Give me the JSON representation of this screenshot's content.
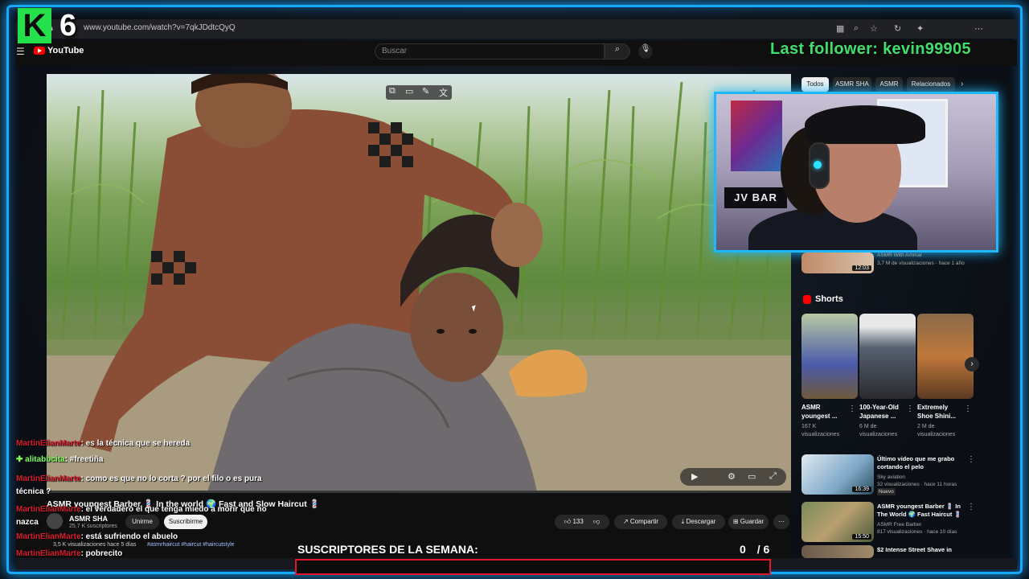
{
  "overlay": {
    "logo_letter": "K",
    "logo_number": "6",
    "last_follower": "Last follower: kevin99905",
    "sub_goal_label": "SUSCRIPTORES DE LA SEMANA:",
    "sub_goal_current": "0",
    "sub_goal_target": "/ 6",
    "sub_goal_progress": 0,
    "accent_color": "#17a9ff"
  },
  "browser": {
    "url": "www.youtube.com/watch?v=7qkJDdtcQyQ"
  },
  "youtube": {
    "logo": "YouTube",
    "search_placeholder": "Buscar",
    "chips": [
      "Todos",
      "ASMR SHA",
      "ASMR",
      "Relacionados"
    ]
  },
  "video": {
    "title": "ASMR youngest Barber 💈 In the world 🌍 Fast and Slow Haircut 💈",
    "channel": "ASMR SHA",
    "subscribers": "25,7 K suscriptores",
    "join_label": "Unirme",
    "subscribe_label": "Suscribirme",
    "likes": "133",
    "share_label": "Compartir",
    "download_label": "Descargar",
    "save_label": "Guardar",
    "views_date": "3,5 K visualizaciones  hace 5 días",
    "tags": "#asmrhaircut #haircut #haircutstyle",
    "progress": 0.0
  },
  "sidebar": {
    "top_item": {
      "channel": "ASMR With Ammar",
      "meta": "3,7 M de visualizaciones · hace 1 año",
      "duration": "12:03"
    },
    "shorts_label": "Shorts",
    "shorts": [
      {
        "title": "ASMR youngest ...",
        "views": "167 K visualizaciones"
      },
      {
        "title": "100-Year-Old Japanese ...",
        "views": "6 M de visualizaciones"
      },
      {
        "title": "Extremely Shoe Shini...",
        "views": "2 M de visualizaciones"
      }
    ],
    "items": [
      {
        "title": "Último video que me grabo cortando el pelo",
        "channel": "Sky aviation",
        "meta": "32 visualizaciones · hace 11 horas",
        "badge": "Nuevo",
        "duration": "16:39"
      },
      {
        "title": "ASMR youngest Barber 💈 In The World 🌍 Fast Haircut 💈",
        "channel": "ASMR Free Barber",
        "meta": "817 visualizaciones · hace 10 días",
        "badge": "",
        "duration": "15:50"
      },
      {
        "title": "$2 Intense Street Shave in",
        "channel": "",
        "meta": "",
        "badge": "",
        "duration": ""
      }
    ]
  },
  "chat": [
    {
      "user": "MartinElianMarte",
      "text": ": es la técnica que se hereda",
      "green": false
    },
    {
      "user": "alitabbcita",
      "text": ": #freetiña",
      "green": true
    },
    {
      "user": "MartinElianMarte",
      "text": ": como es que no lo corta ? por el filo o es pura técnica ?",
      "green": false
    },
    {
      "user": "MartinElianMarte",
      "text": ": el verdadero el que tenga miedo a morir que no nazca",
      "green": false
    },
    {
      "user": "MartinElianMarte",
      "text": ": está sufriendo el abuelo",
      "green": false
    },
    {
      "user": "MartinElianMarte",
      "text": ": pobrecito",
      "green": false
    }
  ]
}
